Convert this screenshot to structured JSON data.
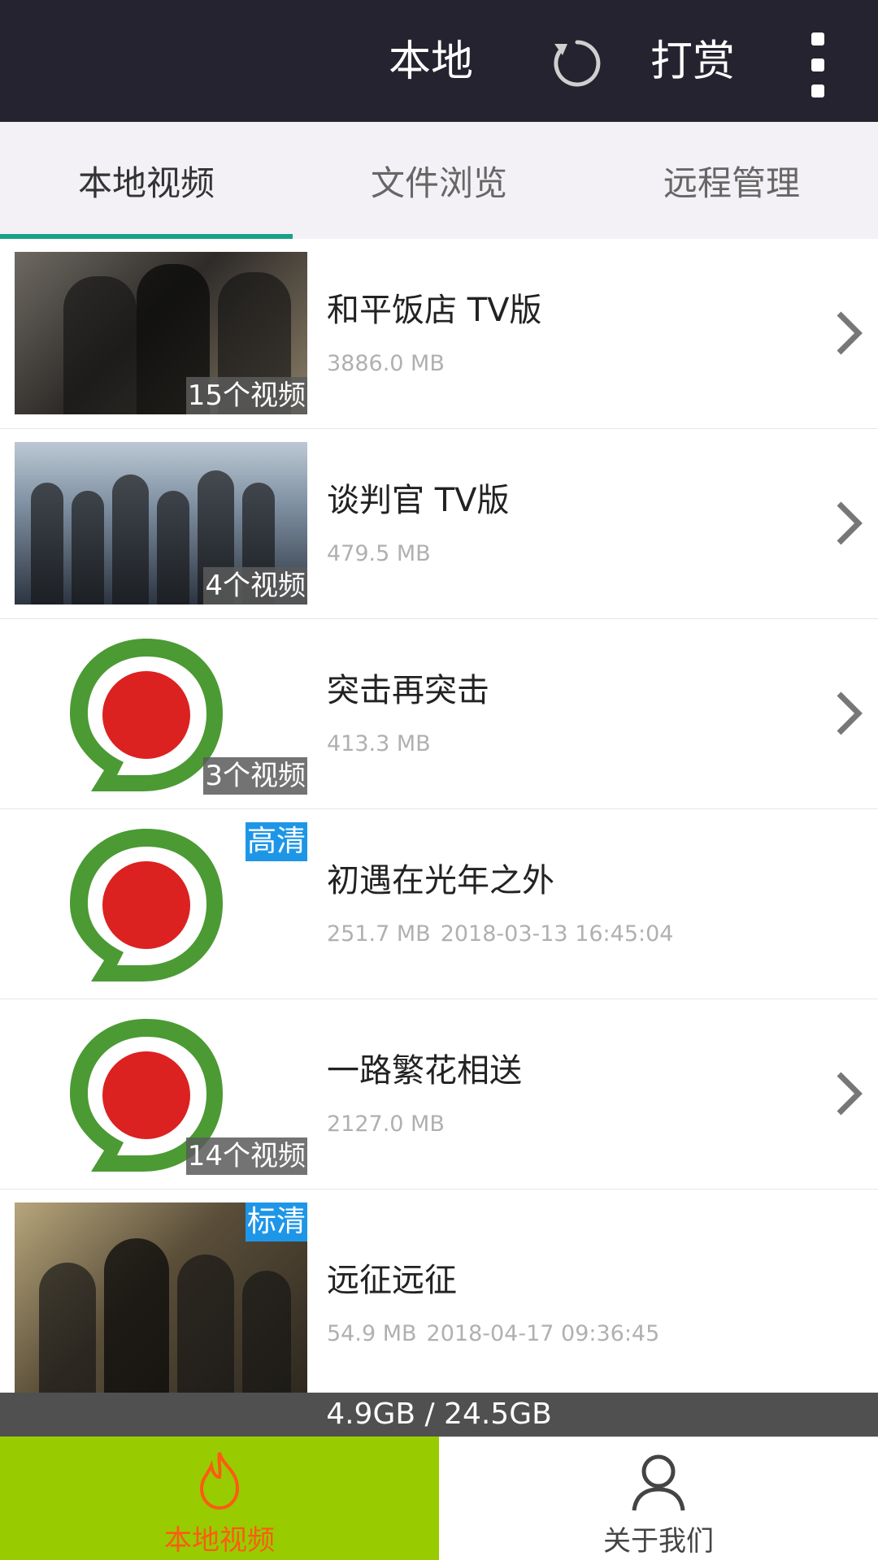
{
  "appbar": {
    "title": "本地",
    "reward_label": "打赏",
    "refresh_icon": "refresh-icon",
    "more_icon": "more-vertical-icon"
  },
  "tabs": [
    {
      "label": "本地视频",
      "active": true
    },
    {
      "label": "文件浏览",
      "active": false
    },
    {
      "label": "远程管理",
      "active": false
    }
  ],
  "items": [
    {
      "title": "和平饭店 TV版",
      "size": "3886.0 MB",
      "date": "",
      "count_badge": "15个视频",
      "quality_badge": "",
      "has_chevron": true
    },
    {
      "title": "谈判官 TV版",
      "size": "479.5 MB",
      "date": "",
      "count_badge": "4个视频",
      "quality_badge": "",
      "has_chevron": true
    },
    {
      "title": "突击再突击",
      "size": "413.3 MB",
      "date": "",
      "count_badge": "3个视频",
      "quality_badge": "",
      "has_chevron": true
    },
    {
      "title": "初遇在光年之外",
      "size": "251.7 MB",
      "date": "2018-03-13 16:45:04",
      "count_badge": "",
      "quality_badge": "高清",
      "has_chevron": false
    },
    {
      "title": "一路繁花相送",
      "size": "2127.0 MB",
      "date": "",
      "count_badge": "14个视频",
      "quality_badge": "",
      "has_chevron": true
    },
    {
      "title": "远征远征",
      "size": "54.9 MB",
      "date": "2018-04-17 09:36:45",
      "count_badge": "",
      "quality_badge": "标清",
      "has_chevron": false
    }
  ],
  "storage": {
    "text": "4.9GB / 24.5GB"
  },
  "bottom_nav": [
    {
      "label": "本地视频",
      "icon": "flame-icon",
      "active": true
    },
    {
      "label": "关于我们",
      "icon": "person-icon",
      "active": false
    }
  ],
  "colors": {
    "appbar_bg": "#24232f",
    "tab_indicator": "#1aa08a",
    "active_nav_bg": "#98cc00",
    "active_nav_text": "#ff5a14",
    "quality_badge_bg": "#1e96e8"
  }
}
